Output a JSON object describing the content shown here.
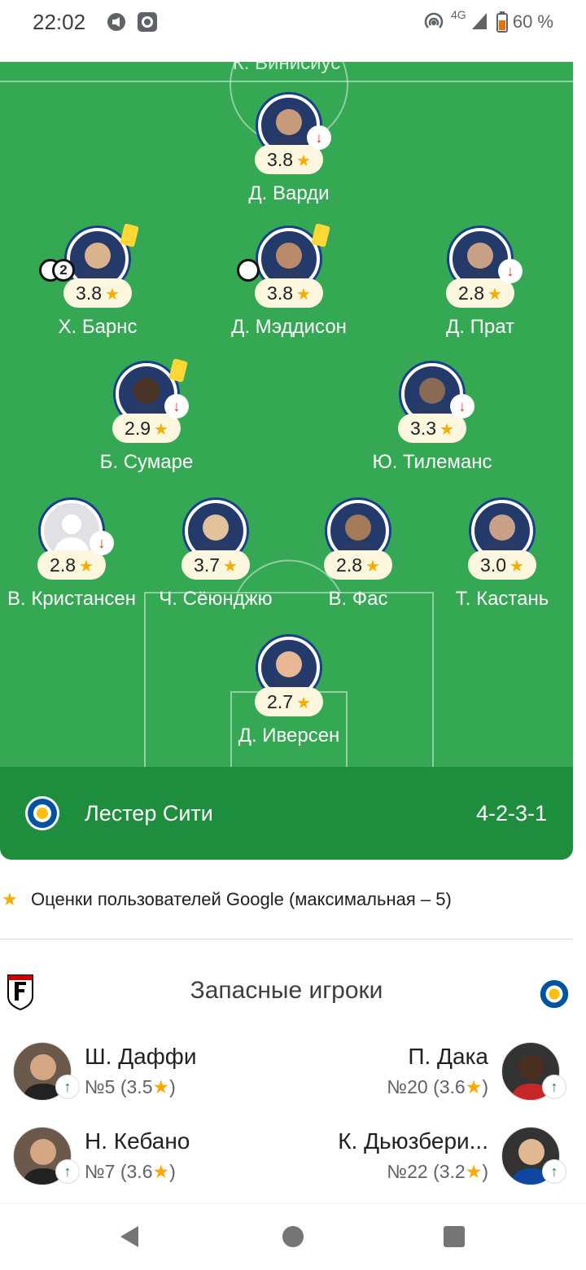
{
  "status_bar": {
    "time": "22:02",
    "network": "4G",
    "battery": "60 %"
  },
  "pitch": {
    "top_label_partial": "К. Винисиус",
    "players": [
      {
        "name": "Д. Варди",
        "rating": "3.8",
        "sub_off": true,
        "yellow": false
      },
      {
        "name": "Х. Барнс",
        "rating": "3.8",
        "sub_off": false,
        "yellow": true,
        "goals": "2"
      },
      {
        "name": "Д. Мэддисон",
        "rating": "3.8",
        "sub_off": false,
        "yellow": true,
        "goal": true
      },
      {
        "name": "Д. Прат",
        "rating": "2.8",
        "sub_off": true,
        "yellow": false
      },
      {
        "name": "Б. Сумаре",
        "rating": "2.9",
        "sub_off": true,
        "yellow": true
      },
      {
        "name": "Ю. Тилеманс",
        "rating": "3.3",
        "sub_off": true,
        "yellow": false
      },
      {
        "name": "В. Кристансен",
        "rating": "2.8",
        "sub_off": true,
        "yellow": false
      },
      {
        "name": "Ч. Сёюнджю",
        "rating": "3.7",
        "sub_off": false,
        "yellow": false
      },
      {
        "name": "В. Фас",
        "rating": "2.8",
        "sub_off": false,
        "yellow": false
      },
      {
        "name": "Т. Кастань",
        "rating": "3.0",
        "sub_off": false,
        "yellow": false
      },
      {
        "name": "Д. Иверсен",
        "rating": "2.7",
        "sub_off": false,
        "yellow": false
      }
    ]
  },
  "team": {
    "name": "Лестер Сити",
    "formation": "4-2-3-1"
  },
  "legend": {
    "text": "Оценки пользователей Google (максимальная – 5)"
  },
  "substitutes": {
    "title": "Запасные игроки",
    "left": [
      {
        "name": "Ш. Даффи",
        "number": "№5 (3.5",
        "star": "★",
        "close": ")"
      },
      {
        "name": "Н. Кебано",
        "number": "№7 (3.6",
        "star": "★",
        "close": ")"
      }
    ],
    "right": [
      {
        "name": "П. Дака",
        "number": "№20 (3.6",
        "star": "★",
        "close": ")"
      },
      {
        "name": "К. Дьюзбери...",
        "number": "№22 (3.2",
        "star": "★",
        "close": ")"
      }
    ]
  },
  "colors": {
    "pitch": "#34a853",
    "team_bar": "#1e8e3e",
    "star": "#f9ab00",
    "sub_off": "#d93025",
    "sub_on": "#188038"
  }
}
